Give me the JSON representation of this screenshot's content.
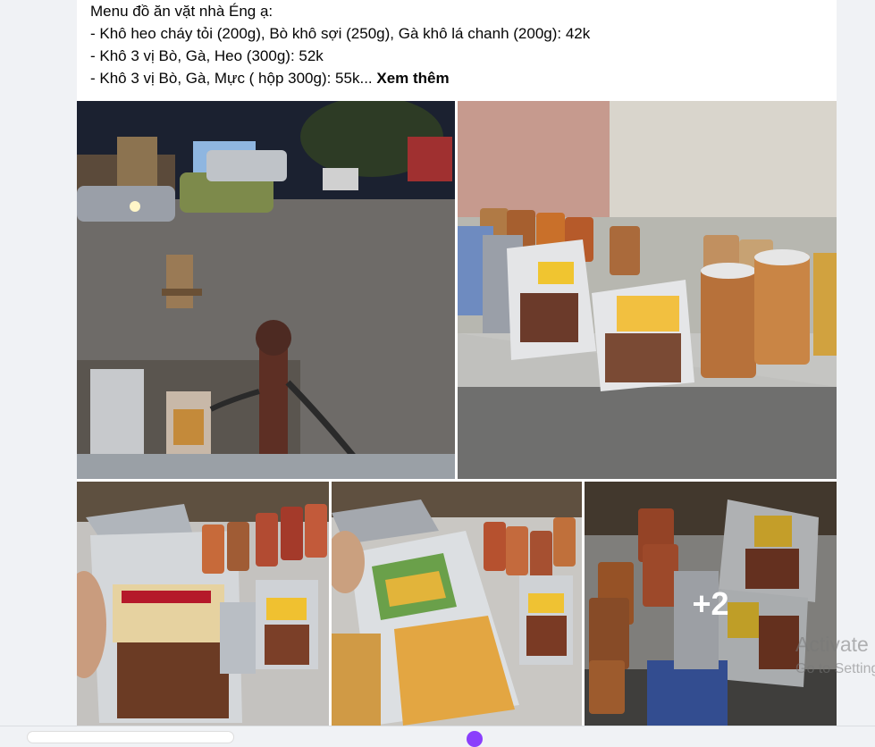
{
  "post": {
    "lines": [
      "Menu đồ ăn vặt nhà Éng ạ:",
      "- Khô heo cháy tỏi (200g), Bò khô sợi (250g), Gà khô lá chanh (200g): 42k",
      "- Khô 3 vị Bò, Gà, Heo (300g): 52k",
      "- Khô 3 vị Bò, Gà, Mực ( hộp 300g): 55k..."
    ],
    "see_more": "Xem thêm"
  },
  "photos": {
    "more_count": "+2",
    "items": [
      {
        "desc": "street-at-night"
      },
      {
        "desc": "snack-jars-on-bench"
      },
      {
        "desc": "pork-jerky-pack"
      },
      {
        "desc": "lemon-chicken-pack"
      },
      {
        "desc": "jars-and-packs"
      }
    ]
  },
  "watermark": {
    "title": "Activate",
    "subtitle": "Go to Settings"
  },
  "colors": {
    "text": "#050505",
    "background": "#f0f2f5",
    "card": "#ffffff"
  }
}
